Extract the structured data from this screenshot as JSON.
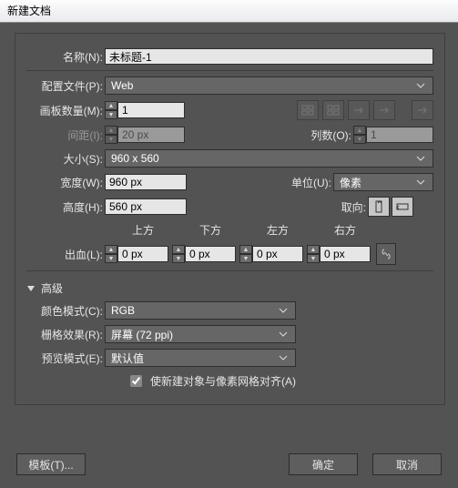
{
  "title": "新建文档",
  "name": {
    "label": "名称(N):",
    "value": "未标题-1"
  },
  "profile": {
    "label": "配置文件(P):",
    "value": "Web"
  },
  "artboards": {
    "label": "画板数量(M):",
    "value": "1"
  },
  "spacing": {
    "label": "间距(I):",
    "value": "20 px"
  },
  "columns": {
    "label": "列数(O):",
    "value": "1"
  },
  "size": {
    "label": "大小(S):",
    "value": "960 x 560"
  },
  "width": {
    "label": "宽度(W):",
    "value": "960 px"
  },
  "height": {
    "label": "高度(H):",
    "value": "560 px"
  },
  "units": {
    "label": "单位(U):",
    "value": "像素"
  },
  "orientation": {
    "label": "取向:"
  },
  "bleed": {
    "label": "出血(L):",
    "cols": {
      "top": "上方",
      "bottom": "下方",
      "left": "左方",
      "right": "右方"
    },
    "values": {
      "top": "0 px",
      "bottom": "0 px",
      "left": "0 px",
      "right": "0 px"
    }
  },
  "advanced": "高级",
  "colormode": {
    "label": "颜色模式(C):",
    "value": "RGB"
  },
  "raster": {
    "label": "栅格效果(R):",
    "value": "屏幕 (72 ppi)"
  },
  "preview": {
    "label": "预览模式(E):",
    "value": "默认值"
  },
  "align": {
    "label": "使新建对象与像素网格对齐(A)",
    "checked": true
  },
  "buttons": {
    "template": "模板(T)...",
    "ok": "确定",
    "cancel": "取消"
  }
}
